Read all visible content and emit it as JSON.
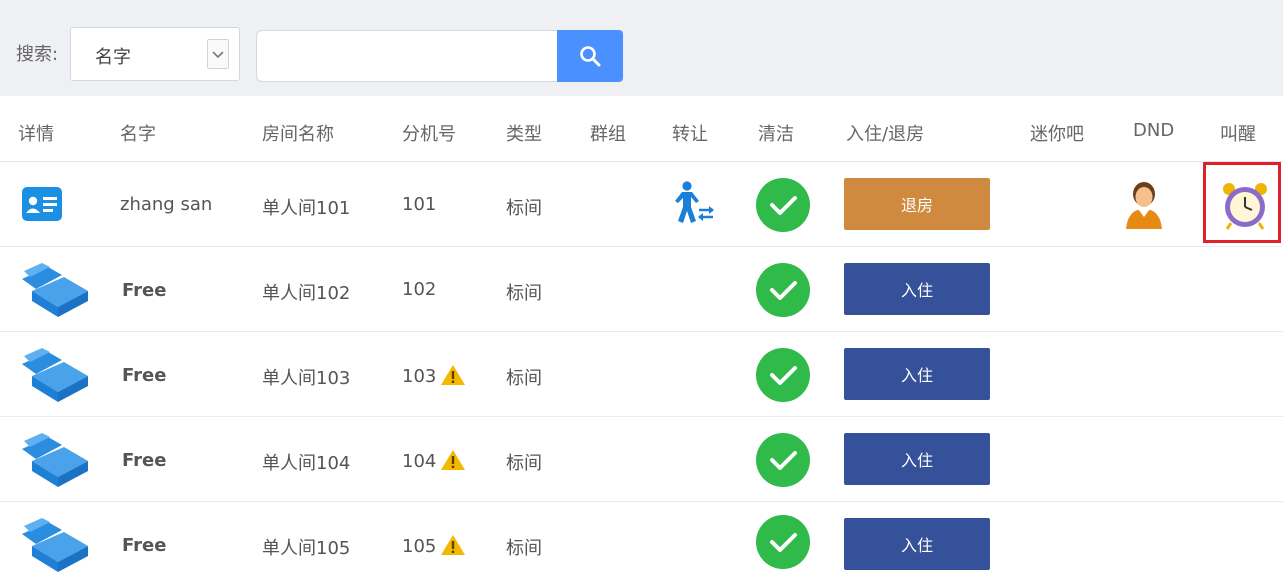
{
  "search": {
    "label": "搜索:",
    "field_selected": "名字",
    "query_value": ""
  },
  "columns": [
    "详情",
    "名字",
    "房间名称",
    "分机号",
    "类型",
    "群组",
    "转让",
    "清洁",
    "入住/退房",
    "迷你吧",
    "DND",
    "叫醒"
  ],
  "rows": [
    {
      "name": "zhang san",
      "room": "单人间101",
      "ext": "101",
      "type": "标间",
      "action": "退房",
      "occupied": true,
      "warning": false
    },
    {
      "name": "Free",
      "room": "单人间102",
      "ext": "102",
      "type": "标间",
      "action": "入住",
      "occupied": false,
      "warning": false
    },
    {
      "name": "Free",
      "room": "单人间103",
      "ext": "103",
      "type": "标间",
      "action": "入住",
      "occupied": false,
      "warning": true
    },
    {
      "name": "Free",
      "room": "单人间104",
      "ext": "104",
      "type": "标间",
      "action": "入住",
      "occupied": false,
      "warning": true
    },
    {
      "name": "Free",
      "room": "单人间105",
      "ext": "105",
      "type": "标间",
      "action": "入住",
      "occupied": false,
      "warning": true
    }
  ],
  "icons": {
    "details_occupied": "guest-card-icon",
    "details_free": "bed-icon",
    "transfer": "transfer-person-icon",
    "clean": "check-circle-icon",
    "dnd": "person-icon",
    "wakeup": "alarm-clock-icon",
    "warning": "warning-triangle-icon"
  },
  "colors": {
    "search_button": "#4a90ff",
    "checkout_button": "#d08a3f",
    "checkin_button": "#34519a",
    "clean_green": "#2fba4a",
    "highlight": "#e0202a"
  }
}
